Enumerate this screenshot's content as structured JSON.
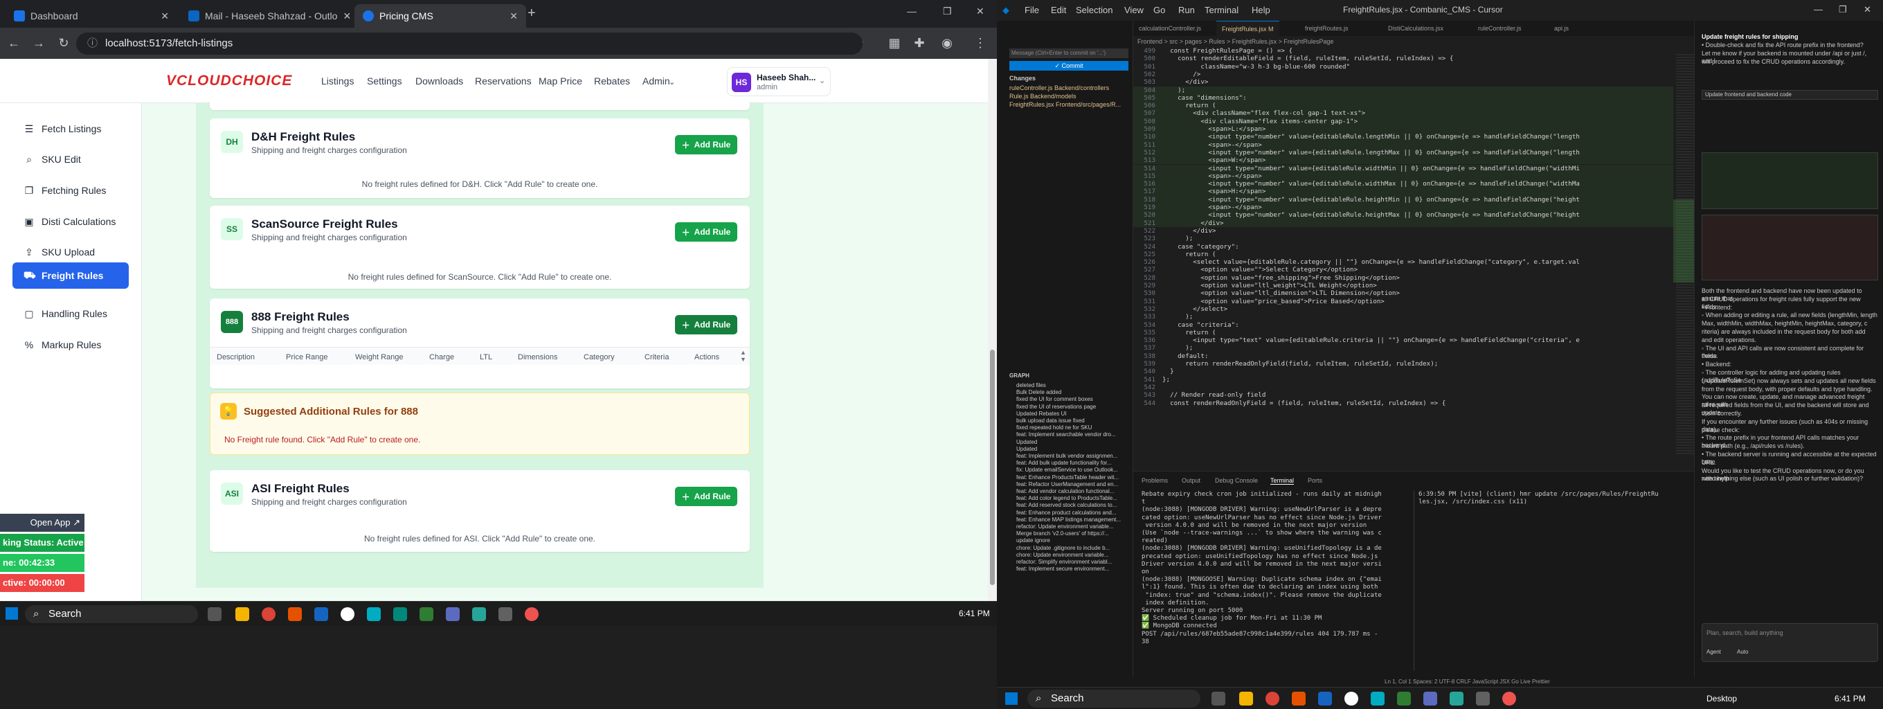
{
  "browser": {
    "tabs": [
      {
        "label": "Dashboard",
        "color": "#1a73e8"
      },
      {
        "label": "Mail - Haseeb Shahzad - Outlo",
        "color": "#0a66c2"
      },
      {
        "label": "Pricing CMS",
        "color": "#1a73e8"
      }
    ],
    "url": "localhost:5173/fetch-listings"
  },
  "app": {
    "logo": "VCLOUDCHOICE",
    "nav": [
      "Listings",
      "Settings",
      "Downloads",
      "Reservations",
      "Map Price",
      "Rebates",
      "Admin"
    ],
    "user": {
      "initials": "HS",
      "name": "Haseeb Shah...",
      "role": "admin"
    },
    "sidebar": [
      {
        "label": "Fetch Listings",
        "icon": "list-icon"
      },
      {
        "label": "SKU Edit",
        "icon": "search-icon"
      },
      {
        "label": "Fetching Rules",
        "icon": "book-icon"
      },
      {
        "label": "Disti Calculations",
        "icon": "calculator-icon"
      },
      {
        "label": "SKU Upload",
        "icon": "upload-icon"
      },
      {
        "label": "Freight Rules",
        "icon": "truck-icon",
        "active": true
      },
      {
        "label": "Handling Rules",
        "icon": "box-icon"
      },
      {
        "label": "Markup Rules",
        "icon": "percent-icon"
      }
    ],
    "add_rule_label": "Add Rule",
    "cards": [
      {
        "badge": "DH",
        "title": "D&H Freight Rules",
        "subtitle": "Shipping and freight charges configuration",
        "empty": "No freight rules defined for D&H. Click \"Add Rule\" to create one."
      },
      {
        "badge": "SS",
        "title": "ScanSource Freight Rules",
        "subtitle": "Shipping and freight charges configuration",
        "empty": "No freight rules defined for ScanSource. Click \"Add Rule\" to create one."
      },
      {
        "badge": "888",
        "title": "888 Freight Rules",
        "subtitle": "Shipping and freight charges configuration"
      },
      {
        "badge": "ASI",
        "title": "ASI Freight Rules",
        "subtitle": "Shipping and freight charges configuration",
        "empty": "No freight rules defined for ASI. Click \"Add Rule\" to create one."
      }
    ],
    "table_headers": [
      "Description",
      "Price Range",
      "Weight Range",
      "Charge",
      "LTL",
      "Dimensions",
      "Category",
      "Criteria",
      "Actions"
    ],
    "suggest": {
      "title": "Suggested Additional Rules for 888",
      "text": "No Freight rule found. Click \"Add Rule\" to create one."
    },
    "overlay": {
      "open_app": "Open App ↗",
      "status": "king Status: Active",
      "timer": "ne: 00:42:33",
      "inactive": "ctive: 00:00:00"
    }
  },
  "taskbar_left": {
    "search": "Search",
    "time": "6:41 PM"
  },
  "taskbar_right": {
    "search": "Search",
    "desktop": "Desktop",
    "time": "6:41 PM"
  },
  "ide": {
    "title": "FreightRules.jsx - Combanic_CMS - Cursor",
    "menu": [
      "File",
      "Edit",
      "Selection",
      "View",
      "Go",
      "Run",
      "Terminal",
      "Help"
    ],
    "commit_label": "✓ Commit",
    "commit_placeholder": "Message (Ctrl+Enter to commit on '...')",
    "changes_label": "Changes",
    "changes": [
      "ruleController.js  Backend/controllers",
      "Rule.js  Backend/models",
      "FreightRules.jsx  Frontend/src/pages/R..."
    ],
    "graph_label": "GRAPH",
    "commits": [
      "deleted files",
      "Bulk Delete added",
      "fixed the UI for comment boxes",
      "fixed the UI of reservations page",
      "Updated Rebates UI",
      "bulk upload data issue fixed",
      "fixed repeated hold ne for SKU",
      "feat: Implement searchable vendor dro...",
      "Updated",
      "Updated",
      "feat: Implement bulk vendor assignmen...",
      "feat: Add bulk update functionality for...",
      "fix: Update emailService to use Outlook...",
      "feat: Enhance ProductsTable header wit...",
      "feat: Refactor UserManagement and en...",
      "feat: Add vendor calculation functional...",
      "feat: Add color legend to ProductsTable...",
      "feat: Add reserved stock calculations to...",
      "feat: Enhance product calculations and...",
      "feat: Enhance MAP listings management...",
      "refactor: Update environment variable...",
      "Merge branch 'v2.0-users' of https://...",
      "update ignore",
      "chore: Update .gitignore to include b...",
      "chore: Update environment variable...",
      "refactor: Simplify environment variabl...",
      "feat: Implement secure environment..."
    ],
    "tabs": [
      "calculationController.js",
      "FreightRules.jsx M",
      "freightRoutes.js",
      "DistiCalculations.jsx",
      "ruleController.js",
      "api.js"
    ],
    "breadcrumbs": "Frontend > src > pages > Rules > FreightRules.jsx > FreightRulesPage",
    "code": [
      {
        "n": "499",
        "t": "  const FreightRulesPage = () => {"
      },
      {
        "n": "500",
        "t": "    const renderEditableField = (field, ruleItem, ruleSetId, ruleIndex) => {"
      },
      {
        "n": "501",
        "t": "          className=\"w-3 h-3 bg-blue-600 rounded\""
      },
      {
        "n": "502",
        "t": "        />"
      },
      {
        "n": "503",
        "t": "      </div>"
      },
      {
        "n": "504",
        "t": "    );"
      },
      {
        "n": "505",
        "t": "    case \"dimensions\":"
      },
      {
        "n": "506",
        "t": "      return ("
      },
      {
        "n": "507",
        "t": "        <div className=\"flex flex-col gap-1 text-xs\">"
      },
      {
        "n": "508",
        "t": "          <div className=\"flex items-center gap-1\">"
      },
      {
        "n": "509",
        "t": "            <span>L:</span>"
      },
      {
        "n": "510",
        "t": "            <input type=\"number\" value={editableRule.lengthMin || 0} onChange={e => handleFieldChange(\"length"
      },
      {
        "n": "511",
        "t": "            <span>-</span>"
      },
      {
        "n": "512",
        "t": "            <input type=\"number\" value={editableRule.lengthMax || 0} onChange={e => handleFieldChange(\"length"
      },
      {
        "n": "513",
        "t": "            <span>W:</span>"
      },
      {
        "n": "514",
        "t": "            <input type=\"number\" value={editableRule.widthMin || 0} onChange={e => handleFieldChange(\"widthMi"
      },
      {
        "n": "515",
        "t": "            <span>-</span>"
      },
      {
        "n": "516",
        "t": "            <input type=\"number\" value={editableRule.widthMax || 0} onChange={e => handleFieldChange(\"widthMa"
      },
      {
        "n": "517",
        "t": "            <span>H:</span>"
      },
      {
        "n": "518",
        "t": "            <input type=\"number\" value={editableRule.heightMin || 0} onChange={e => handleFieldChange(\"height"
      },
      {
        "n": "519",
        "t": "            <span>-</span>"
      },
      {
        "n": "520",
        "t": "            <input type=\"number\" value={editableRule.heightMax || 0} onChange={e => handleFieldChange(\"height"
      },
      {
        "n": "521",
        "t": "          </div>"
      },
      {
        "n": "522",
        "t": "        </div>"
      },
      {
        "n": "523",
        "t": "      );"
      },
      {
        "n": "524",
        "t": "    case \"category\":"
      },
      {
        "n": "525",
        "t": "      return ("
      },
      {
        "n": "526",
        "t": "        <select value={editableRule.category || \"\"} onChange={e => handleFieldChange(\"category\", e.target.val"
      },
      {
        "n": "527",
        "t": "          <option value=\"\">Select Category</option>"
      },
      {
        "n": "528",
        "t": "          <option value=\"free_shipping\">Free Shipping</option>"
      },
      {
        "n": "529",
        "t": "          <option value=\"ltl_weight\">LTL Weight</option>"
      },
      {
        "n": "530",
        "t": "          <option value=\"ltl_dimension\">LTL Dimension</option>"
      },
      {
        "n": "531",
        "t": "          <option value=\"price_based\">Price Based</option>"
      },
      {
        "n": "532",
        "t": "        </select>"
      },
      {
        "n": "533",
        "t": "      );"
      },
      {
        "n": "534",
        "t": "    case \"criteria\":"
      },
      {
        "n": "535",
        "t": "      return ("
      },
      {
        "n": "536",
        "t": "        <input type=\"text\" value={editableRule.criteria || \"\"} onChange={e => handleFieldChange(\"criteria\", e"
      },
      {
        "n": "537",
        "t": "      );"
      },
      {
        "n": "538",
        "t": "    default:"
      },
      {
        "n": "539",
        "t": "      return renderReadOnlyField(field, ruleItem, ruleSetId, ruleIndex);"
      },
      {
        "n": "540",
        "t": "  }"
      },
      {
        "n": "541",
        "t": "};"
      },
      {
        "n": "542",
        "t": ""
      },
      {
        "n": "543",
        "t": "  // Render read-only field"
      },
      {
        "n": "544",
        "t": "  const renderReadOnlyField = (field, ruleItem, ruleSetId, ruleIndex) => {"
      }
    ],
    "panel_tabs": [
      "Problems",
      "Output",
      "Debug Console",
      "Terminal",
      "Ports"
    ],
    "terminal_left": [
      "Rebate expiry check cron job initialized - runs daily at midnigh",
      "t",
      "(node:3088) [MONGODB DRIVER] Warning: useNewUrlParser is a depre",
      "cated option: useNewUrlParser has no effect since Node.js Driver",
      " version 4.0.0 and will be removed in the next major version",
      "(Use `node --trace-warnings ...` to show where the warning was c",
      "reated)",
      "(node:3088) [MONGODB DRIVER] Warning: useUnifiedTopology is a de",
      "precated option: useUnifiedTopology has no effect since Node.js",
      "Driver version 4.0.0 and will be removed in the next major versi",
      "on",
      "(node:3088) [MONGOOSE] Warning: Duplicate schema index on {\"emai",
      "l\":1} found. This is often due to declaring an index using both",
      " \"index: true\" and \"schema.index()\". Please remove the duplicate",
      " index definition.",
      "Server running on port 5000",
      "✅ Scheduled cleanup job for Mon-Fri at 11:30 PM",
      "✅ MongoDB connected",
      "POST /api/rules/687eb55ade87c998c1a4e399/rules 404 179.787 ms -",
      "38"
    ],
    "terminal_right": [
      "6:39:50 PM [vite] (client) hmr update /src/pages/Rules/FreightRu",
      "les.jsx, /src/index.css (x11)"
    ],
    "chat": [
      "Update freight rules for shipping",
      "• Double-check and fix the API route prefix in the frontend?",
      "Let me know if your backend is mounted under /api or just /, and I",
      "will proceed to fix the CRUD operations accordingly."
    ],
    "chat_block": [
      "Update frontend and backend code"
    ],
    "chat_body": [
      "Both the frontend and backend have now been updated to ensure that",
      "all CRUD operations for freight rules fully support the new fields:",
      "• Frontend:",
      "   ◦ When adding or editing a rule, all new fields (lengthMin, length",
      "     Max, widthMin, widthMax, heightMin, heightMax, category, c",
      "     riteria) are always included in the request body for both add",
      "     and edit operations.",
      "   ◦ The UI and API calls are now consistent and complete for these",
      "     fields.",
      "• Backend:",
      "   ◦ The controller logic for adding and updating rules (addRuleToSe",
      "     t, updateRuleInSet) now always sets and updates all new fields",
      "     from the request body, with proper defaults and type handling.",
      "You can now create, update, and manage advanced freight rules with",
      "all required fields from the UI, and the backend will store and update",
      "them correctly.",
      "If you encounter any further issues (such as 404s or missing data),",
      "please check:",
      "• The route prefix in your frontend API calls matches your backend",
      "  mount path (e.g., /api/rules vs /rules).",
      "• The backend server is running and accessible at the expected base",
      "  URL.",
      "Would you like to test the CRUD operations now, or do you need help",
      "with anything else (such as UI polish or further validation)?"
    ],
    "chat_input": "Plan, search, build anything",
    "agent_label": "Agent",
    "auto_label": "Auto",
    "status": "Ln 1, Col 1   Spaces: 2   UTF-8   CRLF   JavaScript JSX   Go Live   Prettier"
  }
}
